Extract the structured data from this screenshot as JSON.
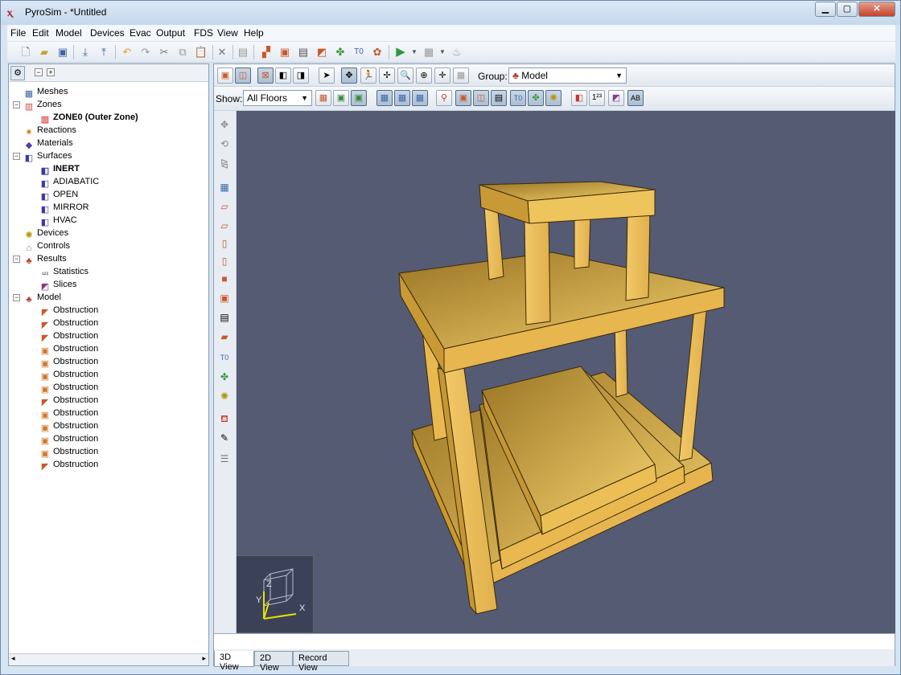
{
  "window": {
    "title": "PyroSim - *Untitled",
    "minimize": "▁",
    "maximize": "▢",
    "close": "✕"
  },
  "menu": [
    "File",
    "Edit",
    "Model",
    "Devices",
    "Evac",
    "Output",
    "FDS",
    "View",
    "Help"
  ],
  "tree": [
    {
      "label": "Meshes",
      "icon": "mesh-icon",
      "indent": 1,
      "bold": false
    },
    {
      "label": "Zones",
      "icon": "zones-icon",
      "indent": 1,
      "bold": false,
      "expander": "−"
    },
    {
      "label": "ZONE0 (Outer Zone)",
      "icon": "zone-icon",
      "indent": 2,
      "bold": true
    },
    {
      "label": "Reactions",
      "icon": "reaction-icon",
      "indent": 1,
      "bold": false
    },
    {
      "label": "Materials",
      "icon": "material-icon",
      "indent": 1,
      "bold": false
    },
    {
      "label": "Surfaces",
      "icon": "surface-icon",
      "indent": 1,
      "bold": false,
      "expander": "−"
    },
    {
      "label": "INERT",
      "icon": "surface-icon",
      "indent": 2,
      "bold": true
    },
    {
      "label": "ADIABATIC",
      "icon": "surface-icon",
      "indent": 2,
      "bold": false
    },
    {
      "label": "OPEN",
      "icon": "surface-icon",
      "indent": 2,
      "bold": false
    },
    {
      "label": "MIRROR",
      "icon": "surface-icon",
      "indent": 2,
      "bold": false
    },
    {
      "label": "HVAC",
      "icon": "surface-icon",
      "indent": 2,
      "bold": false
    },
    {
      "label": "Devices",
      "icon": "device-icon",
      "indent": 1,
      "bold": false
    },
    {
      "label": "Controls",
      "icon": "control-icon",
      "indent": 1,
      "bold": false
    },
    {
      "label": "Results",
      "icon": "results-icon",
      "indent": 1,
      "bold": false,
      "expander": "−"
    },
    {
      "label": "Statistics",
      "icon": "statistics-icon",
      "indent": 2,
      "bold": false
    },
    {
      "label": "Slices",
      "icon": "slices-icon",
      "indent": 2,
      "bold": false
    },
    {
      "label": "Model",
      "icon": "model-icon",
      "indent": 1,
      "bold": false,
      "expander": "−"
    },
    {
      "label": "Obstruction",
      "icon": "wedge-obstruction-icon",
      "indent": 2,
      "bold": false
    },
    {
      "label": "Obstruction",
      "icon": "wedge-obstruction-icon",
      "indent": 2,
      "bold": false
    },
    {
      "label": "Obstruction",
      "icon": "wedge-obstruction-icon",
      "indent": 2,
      "bold": false
    },
    {
      "label": "Obstruction",
      "icon": "box-obstruction-icon",
      "indent": 2,
      "bold": false
    },
    {
      "label": "Obstruction",
      "icon": "box-obstruction-icon",
      "indent": 2,
      "bold": false
    },
    {
      "label": "Obstruction",
      "icon": "box-obstruction-icon",
      "indent": 2,
      "bold": false
    },
    {
      "label": "Obstruction",
      "icon": "box-obstruction-icon",
      "indent": 2,
      "bold": false
    },
    {
      "label": "Obstruction",
      "icon": "wedge-obstruction-icon",
      "indent": 2,
      "bold": false
    },
    {
      "label": "Obstruction",
      "icon": "box-obstruction-icon",
      "indent": 2,
      "bold": false
    },
    {
      "label": "Obstruction",
      "icon": "box-obstruction-icon",
      "indent": 2,
      "bold": false
    },
    {
      "label": "Obstruction",
      "icon": "box-obstruction-icon",
      "indent": 2,
      "bold": false
    },
    {
      "label": "Obstruction",
      "icon": "box-obstruction-icon",
      "indent": 2,
      "bold": false
    },
    {
      "label": "Obstruction",
      "icon": "wedge-obstruction-icon",
      "indent": 2,
      "bold": false
    }
  ],
  "view_toolbar": {
    "group_label": "Group:",
    "group_value": "Model",
    "show_label": "Show:",
    "show_value": "All Floors"
  },
  "axis": {
    "x": "X",
    "y": "Y",
    "z": "Z"
  },
  "tabs": [
    "3D View",
    "2D View",
    "Record View"
  ],
  "active_tab": "3D View",
  "colors": {
    "viewport_bg": "#545b73",
    "obstruction": "#e8b84f"
  }
}
